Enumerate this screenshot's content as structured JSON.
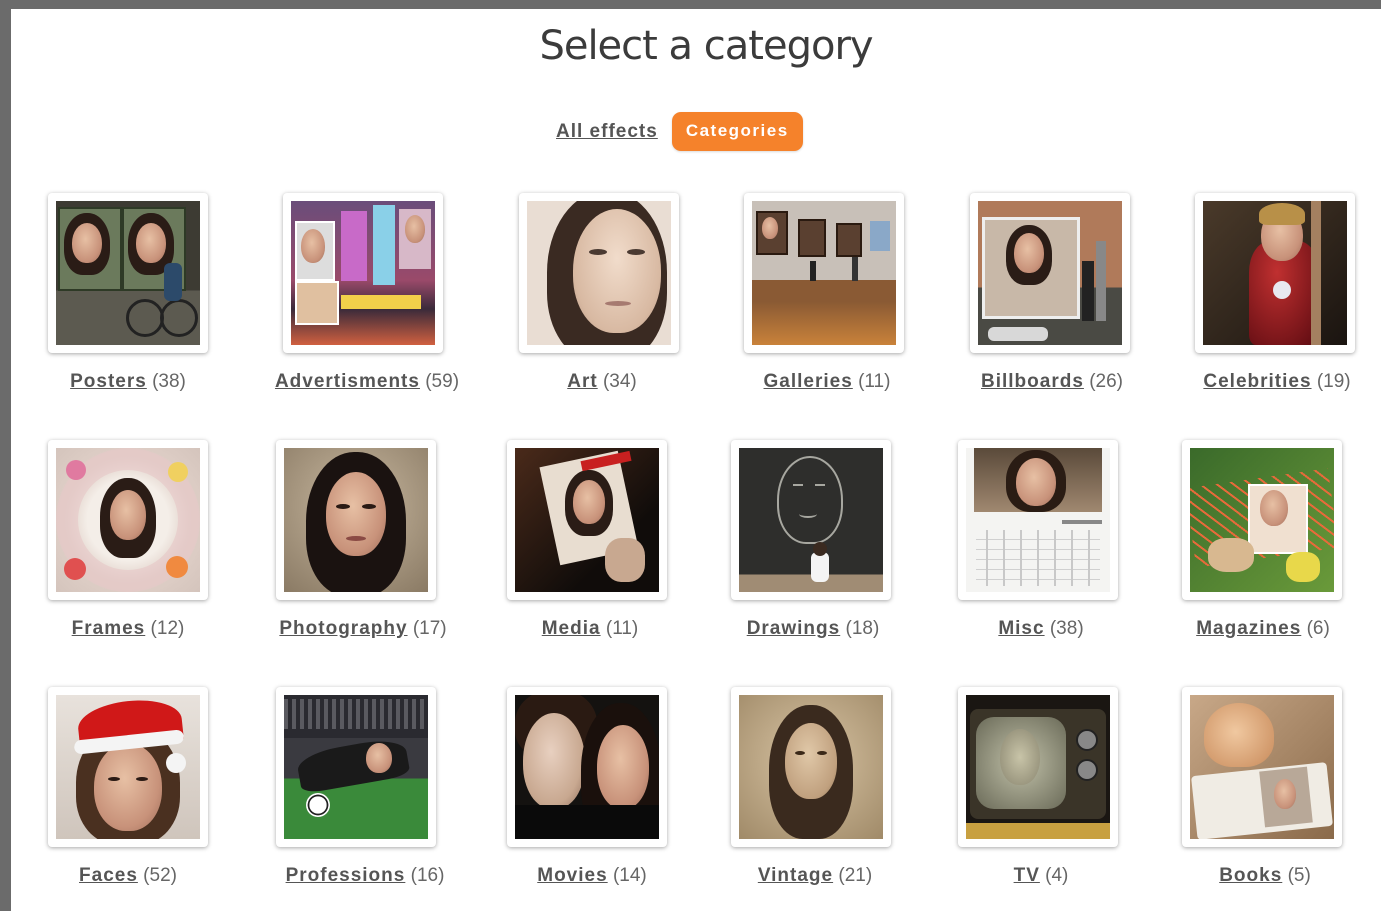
{
  "page": {
    "title": "Select a category"
  },
  "switcher": {
    "all_effects_label": "All effects",
    "categories_label": "Categories",
    "accent_color": "#f5822b"
  },
  "categories": [
    {
      "name": "Posters",
      "count": "(38)"
    },
    {
      "name": "Advertisments",
      "count": "(59)"
    },
    {
      "name": "Art",
      "count": "(34)"
    },
    {
      "name": "Galleries",
      "count": "(11)"
    },
    {
      "name": "Billboards",
      "count": "(26)"
    },
    {
      "name": "Celebrities",
      "count": "(19)"
    },
    {
      "name": "Frames",
      "count": "(12)"
    },
    {
      "name": "Photography",
      "count": "(17)"
    },
    {
      "name": "Media",
      "count": "(11)"
    },
    {
      "name": "Drawings",
      "count": "(18)"
    },
    {
      "name": "Misc",
      "count": "(38)"
    },
    {
      "name": "Magazines",
      "count": "(6)"
    },
    {
      "name": "Faces",
      "count": "(52)"
    },
    {
      "name": "Professions",
      "count": "(16)"
    },
    {
      "name": "Movies",
      "count": "(14)"
    },
    {
      "name": "Vintage",
      "count": "(21)"
    },
    {
      "name": "TV",
      "count": "(4)"
    },
    {
      "name": "Books",
      "count": "(5)"
    }
  ]
}
